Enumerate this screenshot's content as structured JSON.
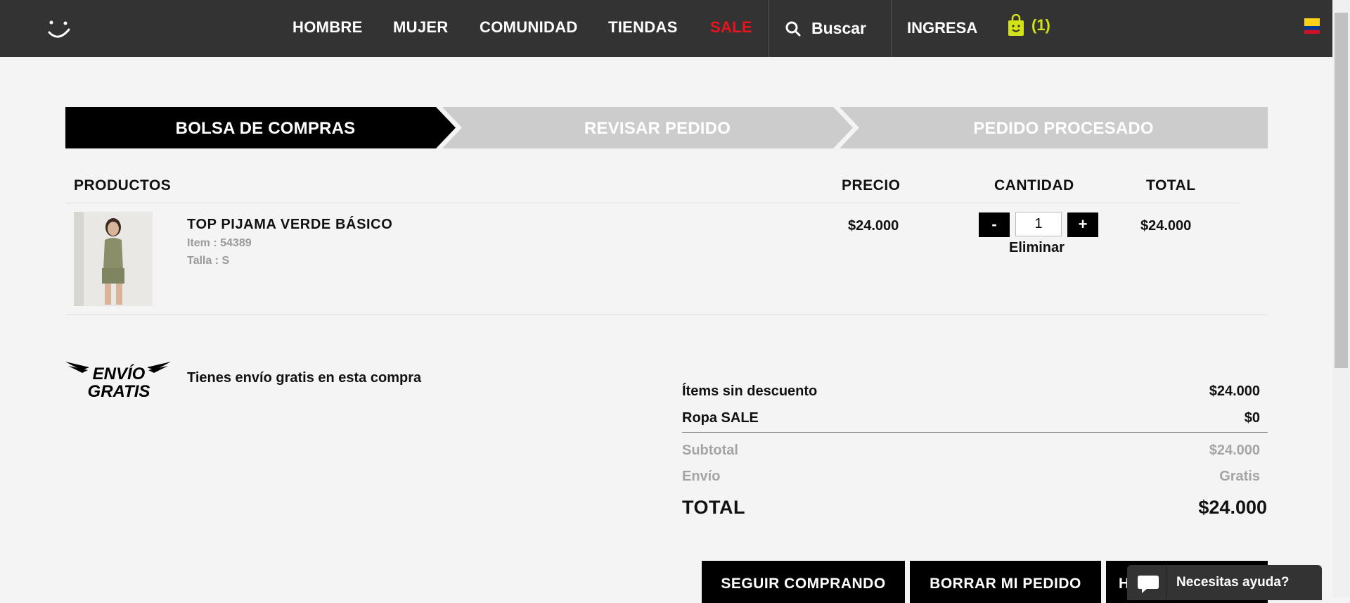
{
  "nav": {
    "items": [
      "HOMBRE",
      "MUJER",
      "COMUNIDAD",
      "TIENDAS",
      "SALE"
    ],
    "search_label": "Buscar",
    "login_label": "INGRESA",
    "cart_count": "(1)"
  },
  "steps": [
    "BOLSA DE COMPRAS",
    "REVISAR PEDIDO",
    "PEDIDO PROCESADO"
  ],
  "table": {
    "headers": {
      "products": "PRODUCTOS",
      "price": "PRECIO",
      "quantity": "CANTIDAD",
      "total": "TOTAL"
    },
    "item": {
      "name": "TOP PIJAMA VERDE BÁSICO",
      "item_code": "Item : 54389",
      "size": "Talla : S",
      "price": "$24.000",
      "quantity": "1",
      "minus": "-",
      "plus": "+",
      "remove": "Eliminar",
      "total": "$24.000"
    }
  },
  "shipping": {
    "logo_text": [
      "ENVÍO",
      "GRATIS"
    ],
    "message": "Tienes envío gratis en esta compra"
  },
  "summary": {
    "rows": [
      {
        "label": "Ítems sin descuento",
        "value": "$24.000"
      },
      {
        "label": "Ropa SALE",
        "value": "$0"
      },
      {
        "label": "Subtotal",
        "value": "$24.000"
      },
      {
        "label": "Envío",
        "value": "Gratis"
      }
    ],
    "total_label": "TOTAL",
    "total_value": "$24.000"
  },
  "buttons": {
    "continue": "SEGUIR COMPRANDO",
    "clear": "BORRAR MI PEDIDO",
    "checkout": "H"
  },
  "help": {
    "label": "Necesitas ayuda?"
  },
  "colors": {
    "topbar": "#333333",
    "sale": "#e8141c",
    "cart": "#d4e21a",
    "active_step": "#000000",
    "inactive_step": "#cccccc"
  }
}
